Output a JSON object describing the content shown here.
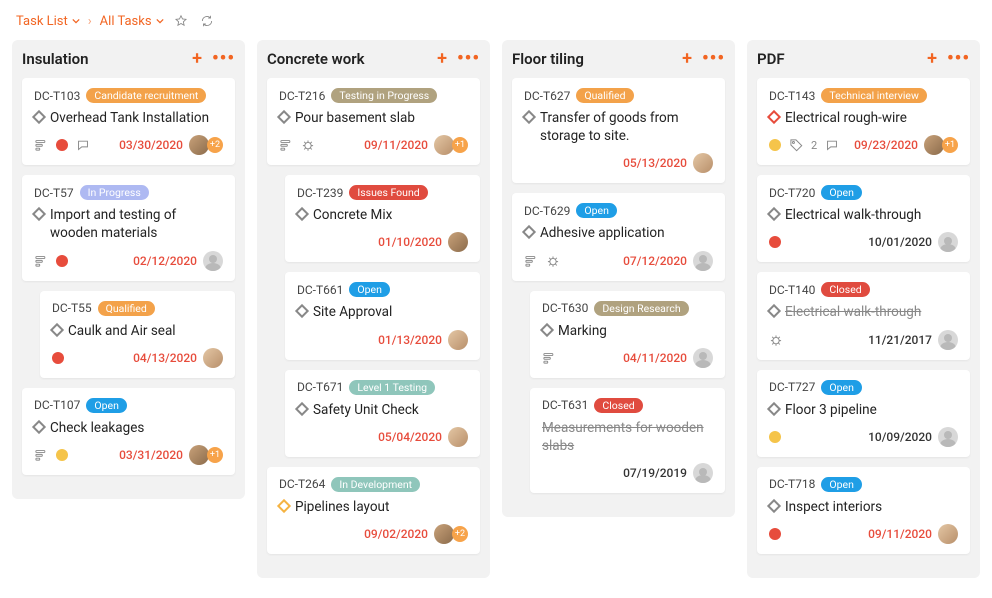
{
  "breadcrumb": {
    "root": "Task List",
    "current": "All Tasks"
  },
  "col_add_label": "+",
  "col_more_label": "•••",
  "columns": [
    {
      "title": "Insulation",
      "cards": [
        {
          "id": "DC-T103",
          "status": {
            "text": "Candidate recruitment",
            "bg": "#f3a24a"
          },
          "title": "Overhead Tank Installation",
          "date": "03/30/2020",
          "date_red": true,
          "diamond": "grey",
          "foot_icons": [
            "subtasks",
            "priority-red",
            "comments"
          ],
          "avatars": [
            "real"
          ],
          "extra_count": "+2",
          "indent": false
        },
        {
          "id": "DC-T57",
          "status": {
            "text": "In Progress",
            "bg": "#aeb9f2"
          },
          "title": "Import and testing of wooden materials",
          "date": "02/12/2020",
          "date_red": true,
          "diamond": "grey",
          "foot_icons": [
            "subtasks",
            "priority-red"
          ],
          "avatars": [
            "placeholder"
          ],
          "indent": false
        },
        {
          "id": "DC-T55",
          "status": {
            "text": "Qualified",
            "bg": "#f3a24a"
          },
          "title": "Caulk and Air seal",
          "date": "04/13/2020",
          "date_red": true,
          "diamond": "grey",
          "foot_icons": [
            "priority-red"
          ],
          "avatars": [
            "real2"
          ],
          "indent": true
        },
        {
          "id": "DC-T107",
          "status": {
            "text": "Open",
            "bg": "#1f9ee6"
          },
          "title": "Check leakages",
          "date": "03/31/2020",
          "date_red": true,
          "diamond": "grey",
          "foot_icons": [
            "subtasks",
            "priority-amber"
          ],
          "avatars": [
            "real"
          ],
          "extra_count": "+1",
          "indent": false
        }
      ]
    },
    {
      "title": "Concrete work",
      "cards": [
        {
          "id": "DC-T216",
          "status": {
            "text": "Testing in Progress",
            "bg": "#b0a27f"
          },
          "title": "Pour basement slab",
          "date": "09/11/2020",
          "date_red": true,
          "diamond": "grey",
          "foot_icons": [
            "subtasks",
            "bug"
          ],
          "avatars": [
            "real2"
          ],
          "extra_count": "+1",
          "indent": false
        },
        {
          "id": "DC-T239",
          "status": {
            "text": "Issues Found",
            "bg": "#e04b3f"
          },
          "title": "Concrete Mix",
          "date": "01/10/2020",
          "date_red": true,
          "diamond": "grey",
          "foot_icons": [],
          "avatars": [
            "real"
          ],
          "indent": true
        },
        {
          "id": "DC-T661",
          "status": {
            "text": "Open",
            "bg": "#1f9ee6"
          },
          "title": "Site Approval",
          "date": "01/13/2020",
          "date_red": true,
          "diamond": "grey",
          "foot_icons": [],
          "avatars": [
            "real2"
          ],
          "indent": true
        },
        {
          "id": "DC-T671",
          "status": {
            "text": "Level 1 Testing",
            "bg": "#8fc6bb"
          },
          "title": "Safety Unit Check",
          "date": "05/04/2020",
          "date_red": true,
          "diamond": "grey",
          "foot_icons": [],
          "avatars": [
            "real2"
          ],
          "indent": true
        },
        {
          "id": "DC-T264",
          "status": {
            "text": "In Development",
            "bg": "#8fc6bb"
          },
          "title": "Pipelines layout",
          "date": "09/02/2020",
          "date_red": true,
          "diamond": "amber",
          "foot_icons": [],
          "avatars": [
            "real"
          ],
          "extra_count": "+2",
          "indent": false
        }
      ]
    },
    {
      "title": "Floor tiling",
      "cards": [
        {
          "id": "DC-T627",
          "status": {
            "text": "Qualified",
            "bg": "#f3a24a"
          },
          "title": "Transfer of goods from storage to site.",
          "date": "05/13/2020",
          "date_red": true,
          "diamond": "grey",
          "foot_icons": [],
          "avatars": [
            "real2"
          ],
          "indent": false
        },
        {
          "id": "DC-T629",
          "status": {
            "text": "Open",
            "bg": "#1f9ee6"
          },
          "title": "Adhesive application",
          "date": "07/12/2020",
          "date_red": true,
          "diamond": "grey",
          "foot_icons": [
            "subtasks",
            "bug"
          ],
          "avatars": [
            "placeholder"
          ],
          "indent": false
        },
        {
          "id": "DC-T630",
          "status": {
            "text": "Design Research",
            "bg": "#b0a27f"
          },
          "title": "Marking",
          "date": "04/11/2020",
          "date_red": true,
          "diamond": "grey",
          "foot_icons": [
            "subtasks"
          ],
          "avatars": [
            "placeholder"
          ],
          "indent": true
        },
        {
          "id": "DC-T631",
          "status": {
            "text": "Closed",
            "bg": "#e04b3f"
          },
          "title": "Measurements for wooden slabs",
          "date": "07/19/2019",
          "date_red": false,
          "diamond": "none",
          "struck": true,
          "foot_icons": [],
          "avatars": [
            "placeholder"
          ],
          "indent": true
        }
      ]
    },
    {
      "title": "PDF",
      "cards": [
        {
          "id": "DC-T143",
          "status": {
            "text": "Technical interview",
            "bg": "#f3a24a"
          },
          "title": "Electrical rough-wire",
          "date": "09/23/2020",
          "date_red": true,
          "diamond": "red",
          "foot_icons": [
            "priority-amber",
            "tag2",
            "comments"
          ],
          "tag_count": "2",
          "avatars": [
            "real"
          ],
          "extra_count": "+1",
          "indent": false
        },
        {
          "id": "DC-T720",
          "status": {
            "text": "Open",
            "bg": "#1f9ee6"
          },
          "title": "Electrical walk-through",
          "date": "10/01/2020",
          "date_red": false,
          "diamond": "grey",
          "foot_icons": [
            "priority-red"
          ],
          "avatars": [
            "placeholder"
          ],
          "indent": false
        },
        {
          "id": "DC-T140",
          "status": {
            "text": "Closed",
            "bg": "#e04b3f"
          },
          "title": "Electrical walk-through",
          "date": "11/21/2017",
          "date_red": false,
          "diamond": "grey",
          "struck": true,
          "foot_icons": [
            "bug"
          ],
          "avatars": [
            "placeholder"
          ],
          "indent": false
        },
        {
          "id": "DC-T727",
          "status": {
            "text": "Open",
            "bg": "#1f9ee6"
          },
          "title": "Floor 3 pipeline",
          "date": "10/09/2020",
          "date_red": false,
          "diamond": "grey",
          "foot_icons": [
            "priority-amber"
          ],
          "avatars": [
            "placeholder"
          ],
          "indent": false
        },
        {
          "id": "DC-T718",
          "status": {
            "text": "Open",
            "bg": "#1f9ee6"
          },
          "title": "Inspect interiors",
          "date": "09/11/2020",
          "date_red": true,
          "diamond": "grey",
          "foot_icons": [
            "priority-red"
          ],
          "avatars": [
            "real2"
          ],
          "indent": false
        }
      ]
    }
  ]
}
